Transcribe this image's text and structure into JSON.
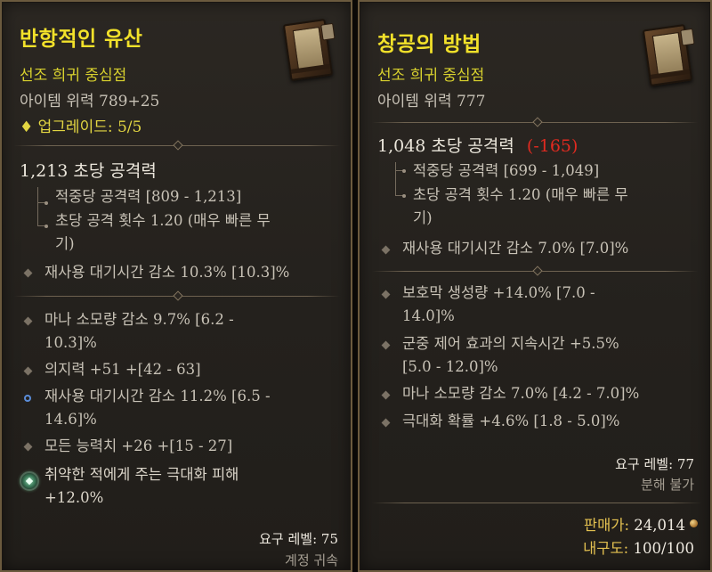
{
  "left_item": {
    "name": "반항적인 유산",
    "rarity": "선조 희귀 중심점",
    "item_power": "아이템 위력 789+25",
    "upgrade_symbol": "♦",
    "upgrade": "업그레이드: 5/5",
    "dps": "1,213 초당 공격력",
    "damage_per_hit": "적중당 공격력 [809 - 1,213]",
    "attack_speed_line1": "초당 공격 횟수 1.20 (매우 빠른 무",
    "attack_speed_line2": "기)",
    "implicit": "재사용 대기시간 감소 10.3% [10.3]%",
    "affixes": [
      {
        "line1": "마나 소모량 감소 9.7% [6.2 -",
        "line2": "10.3]%"
      },
      {
        "line1": "의지력 +51 +[42 - 63]"
      },
      {
        "line1": "재사용 대기시간 감소 11.2% [6.5 -",
        "line2": "14.6]%"
      },
      {
        "line1": "모든 능력치 +26 +[15 - 27]"
      }
    ],
    "gem_line1": "취약한 적에게 주는 극대화 피해",
    "gem_line2": "+12.0%",
    "required_level": "요구 레벨: 75",
    "bound": "계정 귀속"
  },
  "right_item": {
    "name": "창공의 방법",
    "rarity": "선조 희귀 중심점",
    "item_power": "아이템 위력 777",
    "dps": "1,048 초당 공격력",
    "dps_delta": "(-165)",
    "damage_per_hit": "적중당 공격력 [699 - 1,049]",
    "attack_speed_line1": "초당 공격 횟수 1.20 (매우 빠른 무",
    "attack_speed_line2": "기)",
    "implicit": "재사용 대기시간 감소 7.0% [7.0]%",
    "affixes": [
      {
        "line1": "보호막 생성량 +14.0% [7.0 -",
        "line2": "14.0]%"
      },
      {
        "line1": "군중 제어 효과의 지속시간 +5.5%",
        "line2": "[5.0 - 12.0]%"
      },
      {
        "line1": "마나 소모량 감소 7.0% [4.2 - 7.0]%"
      },
      {
        "line1": "극대화 확률 +4.6% [1.8 - 5.0]%"
      }
    ],
    "required_level": "요구 레벨: 77",
    "salvage": "분해 불가",
    "sell_label": "판매가:",
    "sell_value": "24,014",
    "durability_label": "내구도:",
    "durability_value": "100/100"
  },
  "colors": {
    "item_name": "#f2e12a",
    "rarity": "#d7d02e",
    "dps_loss": "#e02a20",
    "frame": "#6b5a3e"
  },
  "icons": {
    "item": "tome-icon",
    "gem": "socketed-gem-icon",
    "coin": "gold-coin-icon"
  }
}
